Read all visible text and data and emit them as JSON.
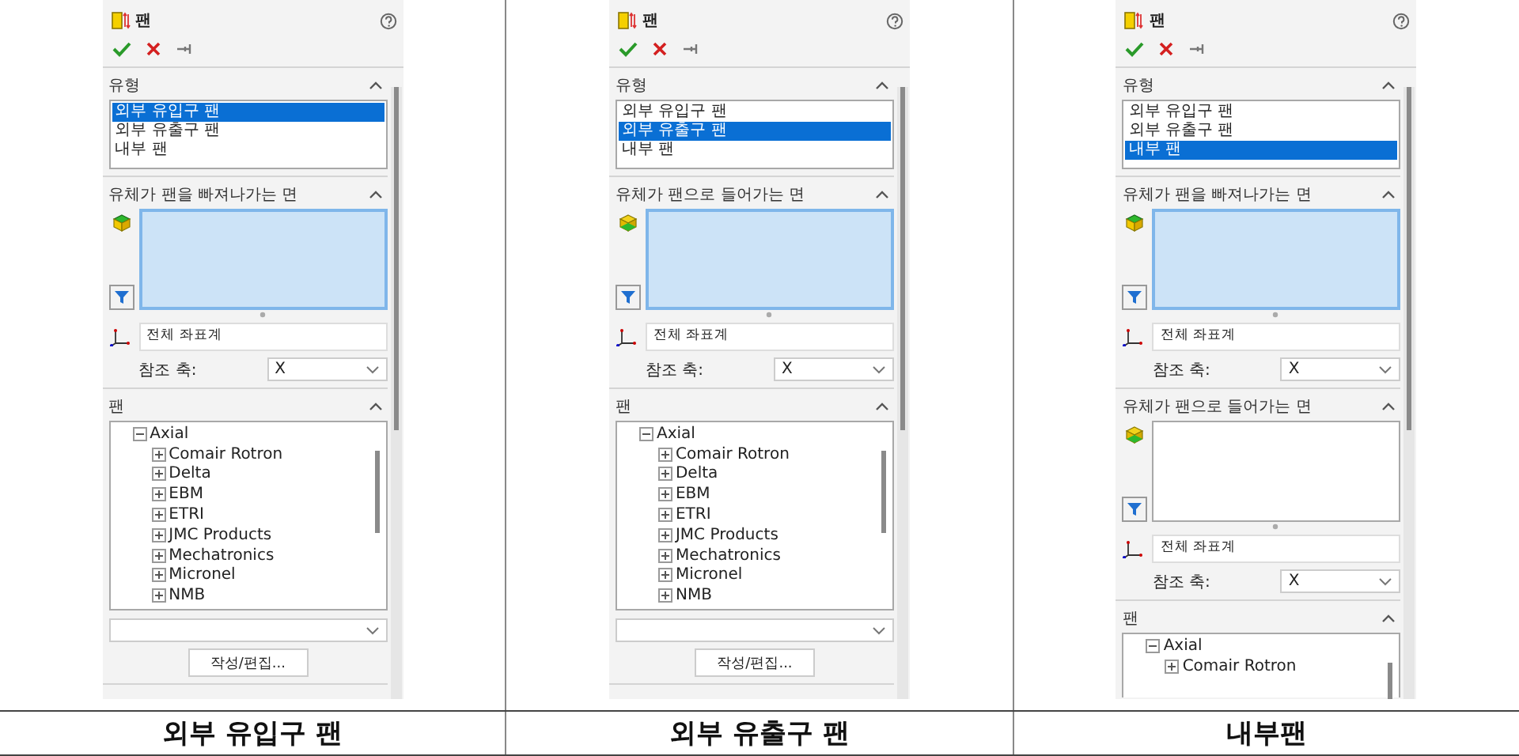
{
  "columns": [
    {
      "panel": {
        "title": "팬",
        "sections": [
          {
            "kind": "type",
            "title": "유형",
            "options": [
              {
                "label": "외부 유입구 팬",
                "selected": true
              },
              {
                "label": "외부 유출구 팬",
                "selected": false
              },
              {
                "label": "내부 팬",
                "selected": false
              }
            ]
          },
          {
            "kind": "outlet_faces",
            "title": "유체가 팬을 빠져나가는 면",
            "active": true,
            "coordinate": "전체 좌표계",
            "axis_label": "참조 축:",
            "axis_value": "X"
          },
          {
            "kind": "fans",
            "title": "팬",
            "tree": [
              {
                "label": "Axial",
                "expanded": true,
                "children": [
                  {
                    "label": "Comair Rotron",
                    "expanded": false
                  },
                  {
                    "label": "Delta",
                    "expanded": false
                  },
                  {
                    "label": "EBM",
                    "expanded": false
                  },
                  {
                    "label": "ETRI",
                    "expanded": false
                  },
                  {
                    "label": "JMC Products",
                    "expanded": false
                  },
                  {
                    "label": "Mechatronics",
                    "expanded": false
                  },
                  {
                    "label": "Micronel",
                    "expanded": false
                  },
                  {
                    "label": "NMB",
                    "expanded": false
                  }
                ]
              }
            ],
            "dropdown": true,
            "button": "작성/편집..."
          }
        ]
      },
      "caption": "외부 유입구 팬"
    },
    {
      "panel": {
        "title": "팬",
        "sections": [
          {
            "kind": "type",
            "title": "유형",
            "options": [
              {
                "label": "외부 유입구 팬",
                "selected": false
              },
              {
                "label": "외부 유출구 팬",
                "selected": true
              },
              {
                "label": "내부 팬",
                "selected": false
              }
            ]
          },
          {
            "kind": "inlet_faces",
            "title": "유체가 팬으로 들어가는 면",
            "active": true,
            "coordinate": "전체 좌표계",
            "axis_label": "참조 축:",
            "axis_value": "X"
          },
          {
            "kind": "fans",
            "title": "팬",
            "tree": [
              {
                "label": "Axial",
                "expanded": true,
                "children": [
                  {
                    "label": "Comair Rotron",
                    "expanded": false
                  },
                  {
                    "label": "Delta",
                    "expanded": false
                  },
                  {
                    "label": "EBM",
                    "expanded": false
                  },
                  {
                    "label": "ETRI",
                    "expanded": false
                  },
                  {
                    "label": "JMC Products",
                    "expanded": false
                  },
                  {
                    "label": "Mechatronics",
                    "expanded": false
                  },
                  {
                    "label": "Micronel",
                    "expanded": false
                  },
                  {
                    "label": "NMB",
                    "expanded": false
                  }
                ]
              }
            ],
            "dropdown": true,
            "button": "작성/편집..."
          }
        ]
      },
      "caption": "외부 유출구 팬"
    },
    {
      "panel": {
        "title": "팬",
        "sections": [
          {
            "kind": "type",
            "title": "유형",
            "options": [
              {
                "label": "외부 유입구 팬",
                "selected": false
              },
              {
                "label": "외부 유출구 팬",
                "selected": false
              },
              {
                "label": "내부 팬",
                "selected": true
              }
            ]
          },
          {
            "kind": "outlet_faces",
            "title": "유체가 팬을 빠져나가는 면",
            "active": true,
            "coordinate": "전체 좌표계",
            "axis_label": "참조 축:",
            "axis_value": "X"
          },
          {
            "kind": "inlet_faces",
            "title": "유체가 팬으로 들어가는 면",
            "active": false,
            "coordinate": "전체 좌표계",
            "axis_label": "참조 축:",
            "axis_value": "X"
          },
          {
            "kind": "fans",
            "title": "팬",
            "tree": [
              {
                "label": "Axial",
                "expanded": true,
                "children": [
                  {
                    "label": "Comair Rotron",
                    "expanded": false
                  }
                ]
              }
            ]
          }
        ]
      },
      "caption": "내부팬"
    }
  ]
}
